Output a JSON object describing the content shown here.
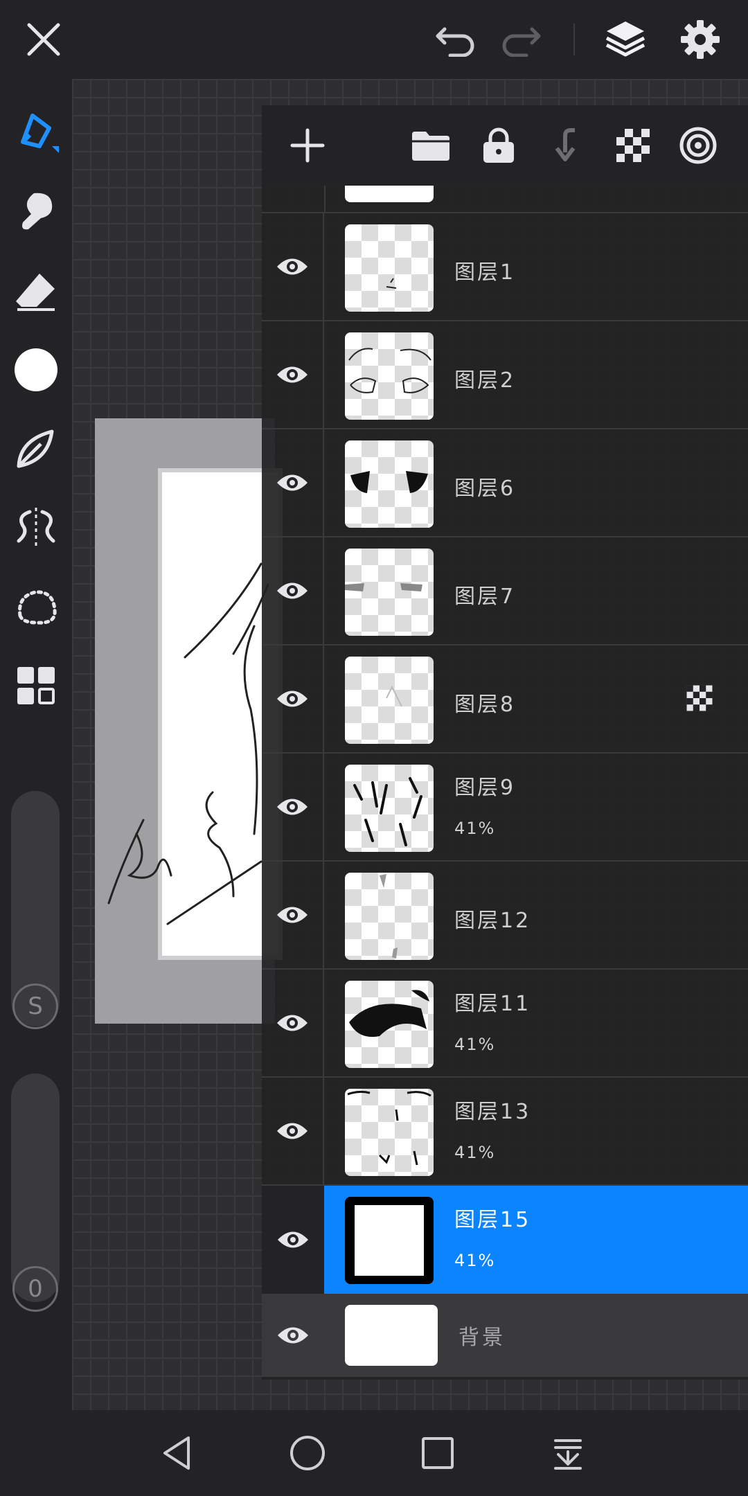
{
  "top_bar": {
    "icons": [
      "close-icon",
      "undo-icon",
      "redo-icon",
      "layers-icon",
      "settings-icon"
    ]
  },
  "toolbar": {
    "tools": [
      "brush-icon",
      "smudge-icon",
      "eraser-icon",
      "color-icon",
      "shape-icon",
      "symmetry-icon",
      "lasso-icon",
      "gallery-icon"
    ],
    "color_swatch": "#ffffff",
    "size_slider_label": "S",
    "opacity_slider_label": "0"
  },
  "layers_panel": {
    "header_icons": [
      "add-layer-icon",
      "folder-icon",
      "lock-icon",
      "merge-down-icon",
      "transparency-icon",
      "target-icon"
    ],
    "layers": [
      {
        "name": "图层1",
        "opacity": ""
      },
      {
        "name": "图层2",
        "opacity": ""
      },
      {
        "name": "图层6",
        "opacity": ""
      },
      {
        "name": "图层7",
        "opacity": ""
      },
      {
        "name": "图层8",
        "opacity": ""
      },
      {
        "name": "图层9",
        "opacity": "41%"
      },
      {
        "name": "图层12",
        "opacity": ""
      },
      {
        "name": "图层11",
        "opacity": "41%"
      },
      {
        "name": "图层13",
        "opacity": "41%"
      },
      {
        "name": "图层15",
        "opacity": "41%"
      }
    ],
    "background_layer": {
      "name": "背景"
    },
    "selected_color": "#0a84ff"
  },
  "nav_bar": {
    "icons": [
      "back-icon",
      "home-icon",
      "recents-icon",
      "menu-down-icon"
    ]
  }
}
